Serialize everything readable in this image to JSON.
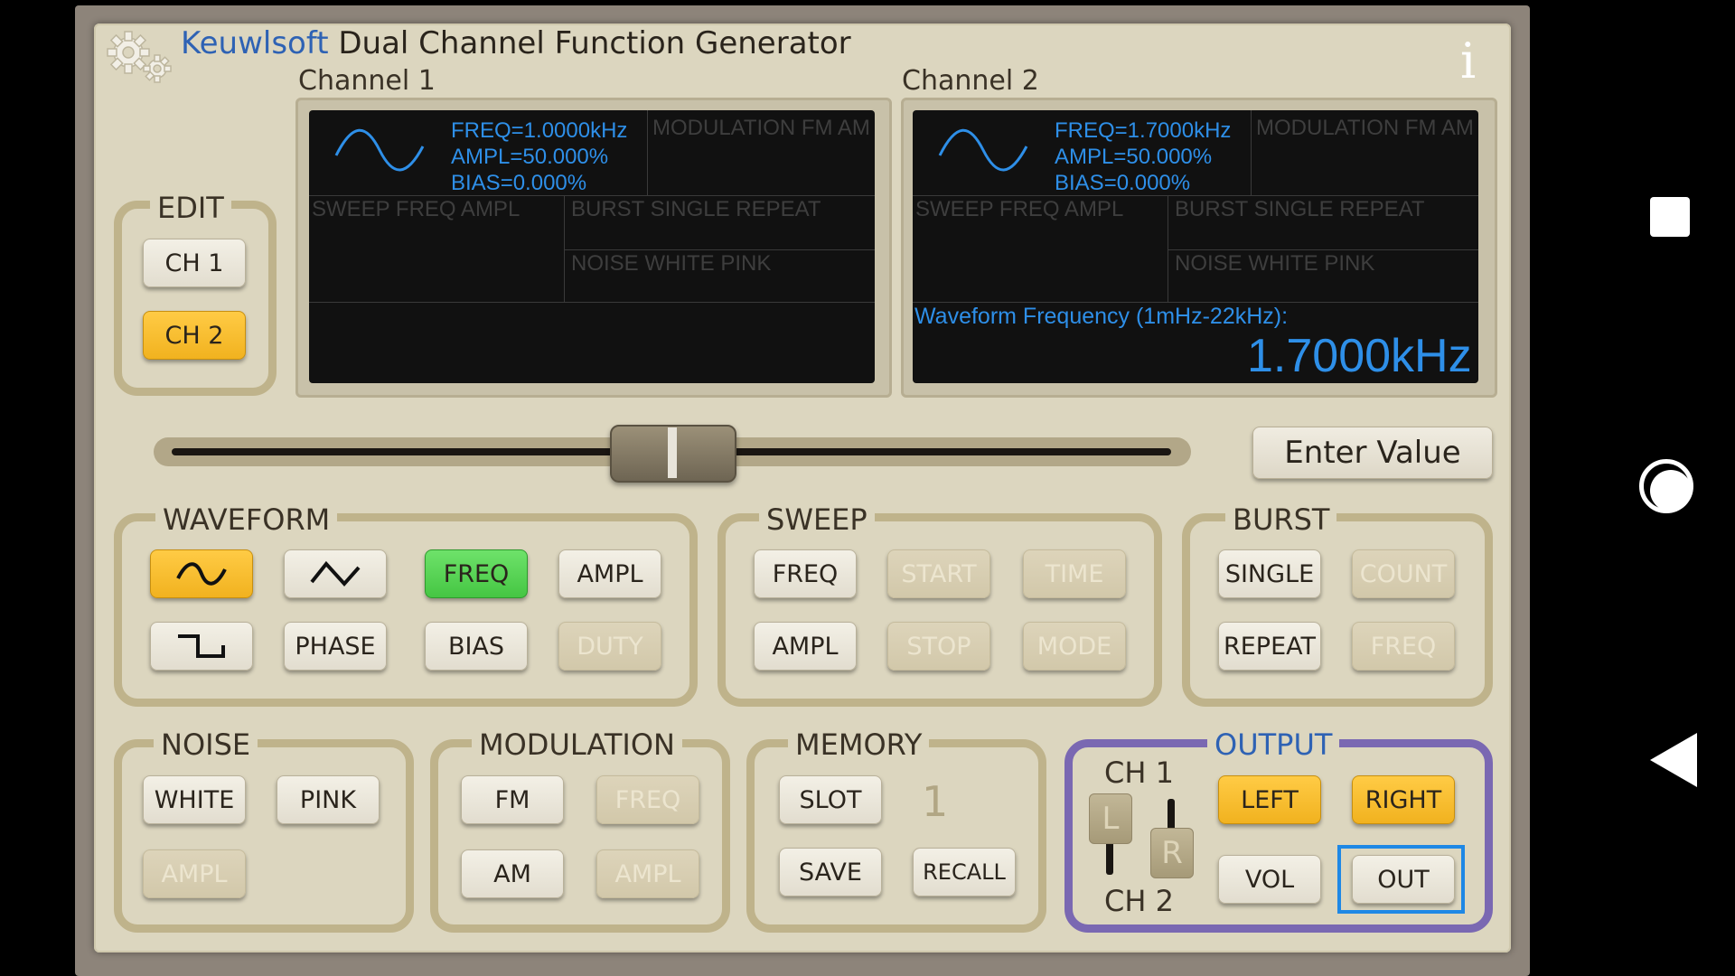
{
  "app": {
    "brand": "Keuwlsoft",
    "title": "Dual Channel Function Generator"
  },
  "icons": {
    "settings": "gears-icon",
    "info": "info-icon",
    "info_glyph": "i"
  },
  "channel1": {
    "label": "Channel 1",
    "freq": "FREQ=1.0000kHz",
    "ampl": "AMPL=50.000%",
    "bias": "BIAS=0.000%",
    "modulation": "MODULATION  FM  AM",
    "sweep": "SWEEP   FREQ  AMPL",
    "burst": "BURST   SINGLE  REPEAT",
    "noise": "NOISE   WHITE   PINK"
  },
  "channel2": {
    "label": "Channel 2",
    "freq": "FREQ=1.7000kHz",
    "ampl": "AMPL=50.000%",
    "bias": "BIAS=0.000%",
    "modulation": "MODULATION  FM  AM",
    "sweep": "SWEEP   FREQ  AMPL",
    "burst": "BURST   SINGLE  REPEAT",
    "noise": "NOISE   WHITE   PINK",
    "prompt": "Waveform Frequency (1mHz-22kHz):",
    "value": "1.7000kHz"
  },
  "edit": {
    "label": "EDIT",
    "ch1": "CH 1",
    "ch2": "CH 2",
    "active": "CH 2"
  },
  "slider": {
    "position_fraction": 0.5
  },
  "enter_value": "Enter Value",
  "waveform": {
    "label": "WAVEFORM",
    "sine": "sine-wave-icon",
    "triangle": "triangle-wave-icon",
    "square": "square-wave-icon",
    "freq": "FREQ",
    "ampl": "AMPL",
    "phase": "PHASE",
    "bias": "BIAS",
    "duty": "DUTY"
  },
  "sweep": {
    "label": "SWEEP",
    "freq": "FREQ",
    "start": "START",
    "time": "TIME",
    "ampl": "AMPL",
    "stop": "STOP",
    "mode": "MODE"
  },
  "burst": {
    "label": "BURST",
    "single": "SINGLE",
    "count": "COUNT",
    "repeat": "REPEAT",
    "freq": "FREQ"
  },
  "noise": {
    "label": "NOISE",
    "white": "WHITE",
    "pink": "PINK",
    "ampl": "AMPL"
  },
  "modulation": {
    "label": "MODULATION",
    "fm": "FM",
    "freq": "FREQ",
    "am": "AM",
    "ampl": "AMPL"
  },
  "memory": {
    "label": "MEMORY",
    "slot": "SLOT",
    "slot_number": "1",
    "save": "SAVE",
    "recall": "RECALL"
  },
  "output": {
    "label": "OUTPUT",
    "ch1": "CH 1",
    "ch2": "CH 2",
    "l": "L",
    "r": "R",
    "left": "LEFT",
    "right": "RIGHT",
    "vol": "VOL",
    "out": "OUT"
  },
  "colors": {
    "accent_yellow": "#f1b21f",
    "active_green": "#45c643",
    "screen_blue": "#2e8fe8",
    "focus_blue": "#1e88e5",
    "output_border": "#7a68b2"
  }
}
